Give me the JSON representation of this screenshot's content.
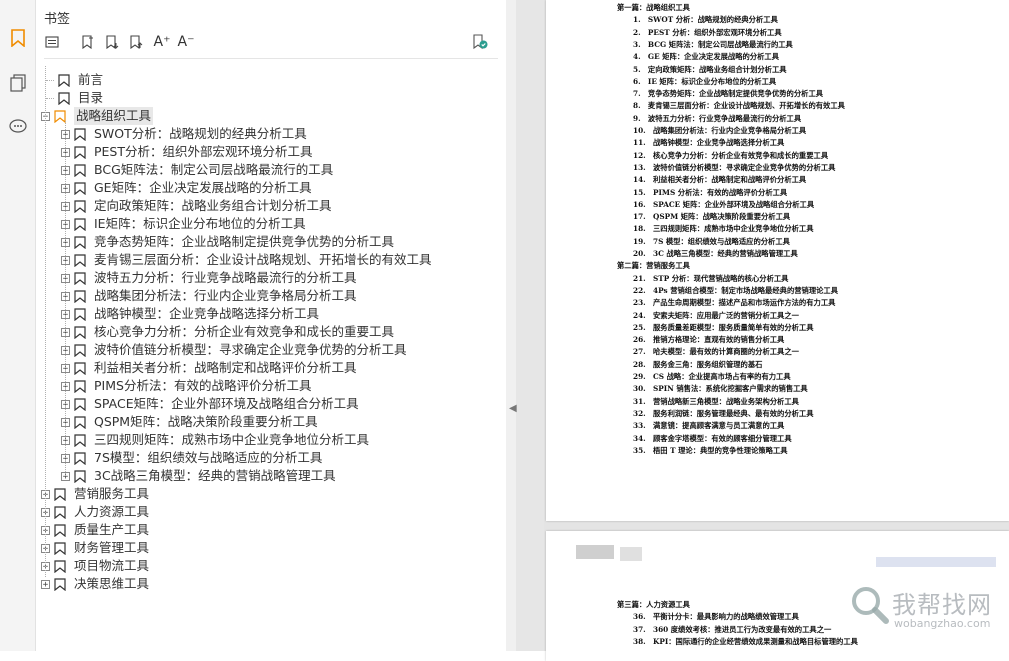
{
  "sidebar": {
    "title": "书签"
  },
  "toolbar": {
    "icons": [
      "outline-icon",
      "bookmark-add-icon",
      "bookmark-down-icon",
      "bookmark-up-icon",
      "font-larger-icon",
      "font-smaller-icon",
      "bookmark-check-icon"
    ],
    "font_larger_label": "A⁺",
    "font_smaller_label": "A⁻"
  },
  "tree": {
    "top_items": [
      "前言",
      "目录"
    ],
    "chapter1": "战略组织工具",
    "chapter1_items": [
      "SWOT分析：战略规划的经典分析工具",
      "PEST分析：组织外部宏观环境分析工具",
      "BCG矩阵法：制定公司层战略最流行的工具",
      "GE矩阵：企业决定发展战略的分析工具",
      "定向政策矩阵：战略业务组合计划分析工具",
      "IE矩阵：标识企业分布地位的分析工具",
      "竞争态势矩阵：企业战略制定提供竞争优势的分析工具",
      "麦肯锡三层面分析：企业设计战略规划、开拓增长的有效工具",
      "波特五力分析：行业竞争战略最流行的分析工具",
      "战略集团分析法：行业内企业竞争格局分析工具",
      "战略钟模型：企业竞争战略选择分析工具",
      "核心竞争力分析：分析企业有效竞争和成长的重要工具",
      "波特价值链分析模型：寻求确定企业竞争优势的分析工具",
      "利益相关者分析：战略制定和战略评价分析工具",
      "PIMS分析法：有效的战略评价分析工具",
      "SPACE矩阵：企业外部环境及战略组合分析工具",
      "QSPM矩阵：战略决策阶段重要分析工具",
      "三四规则矩阵：成熟市场中企业竞争地位分析工具",
      "7S模型：组织绩效与战略适应的分析工具",
      "3C战略三角模型：经典的营销战略管理工具"
    ],
    "other_chapters": [
      "营销服务工具",
      "人力资源工具",
      "质量生产工具",
      "财务管理工具",
      "项目物流工具",
      "决策思维工具"
    ]
  },
  "doc": {
    "page1_lines": [
      "第一篇：战略组织工具",
      "1.　SWOT 分析：战略规划的经典分析工具",
      "2.　PEST 分析：组织外部宏观环境分析工具",
      "3.　BCG 矩阵法：制定公司层战略最流行的工具",
      "4.　GE 矩阵：企业决定发展战略的分析工具",
      "5.　定向政策矩阵：战略业务组合计划分析工具",
      "6.　IE 矩阵：标识企业分布地位的分析工具",
      "7.　竞争态势矩阵：企业战略制定提供竞争优势的分析工具",
      "8.　麦肯锡三层面分析：企业设计战略规划、开拓增长的有效工具",
      "9.　波特五力分析：行业竞争战略最流行的分析工具",
      "10.　战略集团分析法：行业内企业竞争格局分析工具",
      "11.　战略钟模型：企业竞争战略选择分析工具",
      "12.　核心竞争力分析：分析企业有效竞争和成长的重要工具",
      "13.　波特价值链分析模型：寻求确定企业竞争优势的分析工具",
      "14.　利益相关者分析：战略制定和战略评价分析工具",
      "15.　PIMS 分析法：有效的战略评价分析工具",
      "16.　SPACE 矩阵：企业外部环境及战略组合分析工具",
      "17.　QSPM 矩阵：战略决策阶段重要分析工具",
      "18.　三四规则矩阵：成熟市场中企业竞争地位分析工具",
      "19.　7S 模型：组织绩效与战略适应的分析工具",
      "20.　3C 战略三角模型：经典的营销战略管理工具",
      "第二篇：营销服务工具",
      "21.　STP 分析：现代营销战略的核心分析工具",
      "22.　4Ps 营销组合模型：制定市场战略最经典的营销理论工具",
      "23.　产品生命周期模型：描述产品和市场运作方法的有力工具",
      "24.　安索夫矩阵：应用最广泛的营销分析工具之一",
      "25.　服务质量差距模型：服务质量简单有效的分析工具",
      "26.　推销方格理论：直观有效的销售分析工具",
      "27.　哈夫模型：最有效的计算商圈的分析工具之一",
      "28.　服务金三角：服务组织管理的基石",
      "29.　CS 战略：企业提高市场占有率的有力工具",
      "30.　SPIN 销售法：系统化挖掘客户需求的销售工具",
      "31.　营销战略新三角模型：战略业务架构分析工具",
      "32.　服务利润链：服务管理最经典、最有效的分析工具",
      "33.　满意镜：提高顾客满意与员工满意的工具",
      "34.　顾客金字塔模型：有效的顾客细分管理工具",
      "35.　梧田 T 理论：典型的竞争性理论策略工具"
    ],
    "page2_lines": [
      "第三篇：人力资源工具",
      "36.　平衡计分卡：最具影响力的战略绩效管理工具",
      "37.　360 度绩效考核：推进员工行为改变最有效的工具之一",
      "38.　KPI：国际通行的企业经营绩效成果测量和战略目标管理的工具"
    ],
    "watermark_cn": "我帮找网",
    "watermark_url": "wobangzhao.com"
  },
  "colors": {
    "accent": "#f08c00",
    "rail_bg": "#f4f4f4",
    "doc_bg": "#e4e4e4"
  }
}
